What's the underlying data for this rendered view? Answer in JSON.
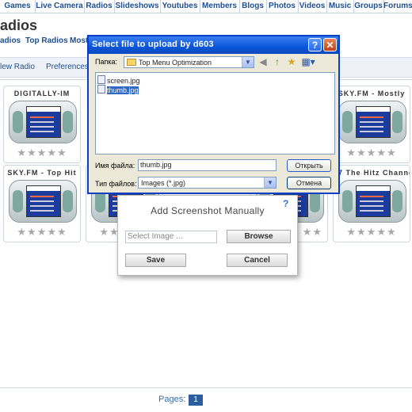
{
  "top_nav": [
    {
      "label": "Games"
    },
    {
      "label": "Live Camera"
    },
    {
      "label": "Radios"
    },
    {
      "label": "Slideshows"
    },
    {
      "label": "Youtubes"
    },
    {
      "label": "Members"
    },
    {
      "label": "Blogs"
    },
    {
      "label": "Photos"
    },
    {
      "label": "Videos"
    },
    {
      "label": "Music"
    },
    {
      "label": "Groups"
    },
    {
      "label": "Forums"
    }
  ],
  "page_title": "adios",
  "subnav": {
    "radios": "adios",
    "top_radios": "Top Radios",
    "most": "Most"
  },
  "bar2": {
    "new_radio": "lew Radio",
    "preferences": "Preferences"
  },
  "cards": [
    {
      "name": "DIGITALLY-IM",
      "stars": "★★★★★"
    },
    {
      "name": "SKY.FM - Mostly",
      "stars": "★★★★★"
    },
    {
      "name": "SKY.FM - Top Hit",
      "stars": "★★★★★"
    },
    {
      "name": "",
      "stars": "★★★★★"
    },
    {
      "name": "",
      "stars": "★★"
    },
    {
      "name": "77 The Hitz Channel",
      "stars": "★★★★★"
    }
  ],
  "add_screenshot": {
    "title": "Add Screenshot Manually",
    "help_icon": "?",
    "input_placeholder": "Select Image ...",
    "browse_label": "Browse",
    "save_label": "Save",
    "cancel_label": "Cancel"
  },
  "file_dialog": {
    "title": "Select file to upload by d603",
    "help_btn": "?",
    "close_btn": "✕",
    "folder_label": "Папка:",
    "folder_value": "Top Menu Optimization",
    "files": [
      {
        "name": "screen.jpg",
        "selected": false
      },
      {
        "name": "thumb.jpg",
        "selected": true
      }
    ],
    "filename_label": "Имя файла:",
    "filename_value": "thumb.jpg",
    "filetype_label": "Тип файлов:",
    "filetype_value": "Images (*.jpg)",
    "open_label": "Открыть",
    "cancel_label": "Отмена"
  },
  "pager": {
    "label": "Pages:",
    "current": "1"
  },
  "colors": {
    "title_bar": "#0a56d9",
    "selection": "#316ac5",
    "link": "#1d4f91",
    "page_button": "#2a5e9e"
  }
}
